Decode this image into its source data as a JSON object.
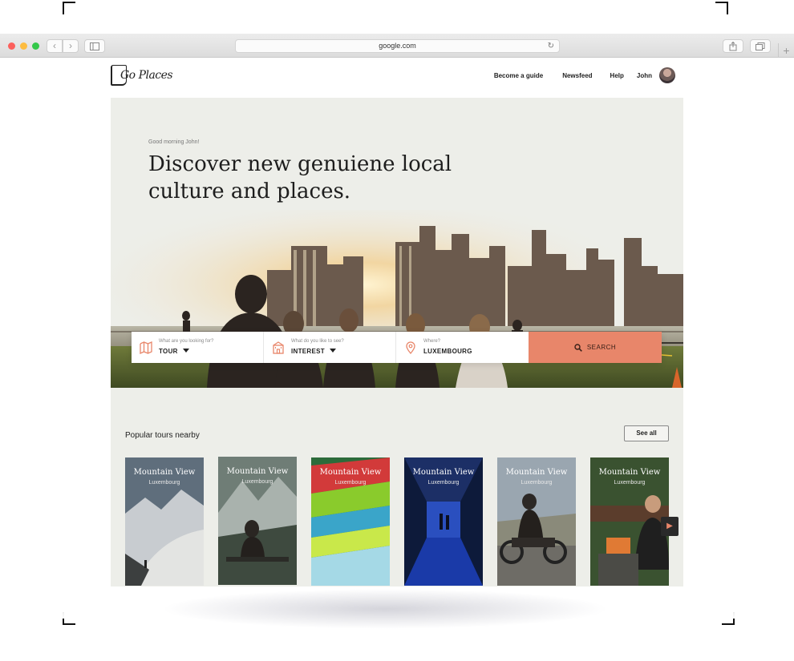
{
  "browser": {
    "url": "google.com"
  },
  "site": {
    "logo_text": "Go Places",
    "nav": {
      "become_guide": "Become a guide",
      "newsfeed": "Newsfeed",
      "help": "Help",
      "user": "John"
    }
  },
  "hero": {
    "greeting": "Good morning John!",
    "headline": "Discover new genuiene local culture and places."
  },
  "search": {
    "fields": [
      {
        "label": "What are you looking for?",
        "value": "TOUR",
        "icon": "map-icon"
      },
      {
        "label": "What do you like to see?",
        "value": "INTEREST",
        "icon": "building-icon"
      },
      {
        "label": "Where?",
        "value": "LUXEMBOURG",
        "icon": "location-pin-icon"
      }
    ],
    "button_label": "SEARCH",
    "accent_color": "#e8866a"
  },
  "popular": {
    "title": "Popular tours nearby",
    "see_all": "See all",
    "cards": [
      {
        "title": "Mountain View",
        "subtitle": "Luxembourg"
      },
      {
        "title": "Mountain View",
        "subtitle": "Luxembourg"
      },
      {
        "title": "Mountain View",
        "subtitle": "Luxembourg"
      },
      {
        "title": "Mountain View",
        "subtitle": "Luxembourg"
      },
      {
        "title": "Mountain View",
        "subtitle": "Luxembourg"
      },
      {
        "title": "Mountain View",
        "subtitle": "Luxembourg"
      }
    ]
  }
}
